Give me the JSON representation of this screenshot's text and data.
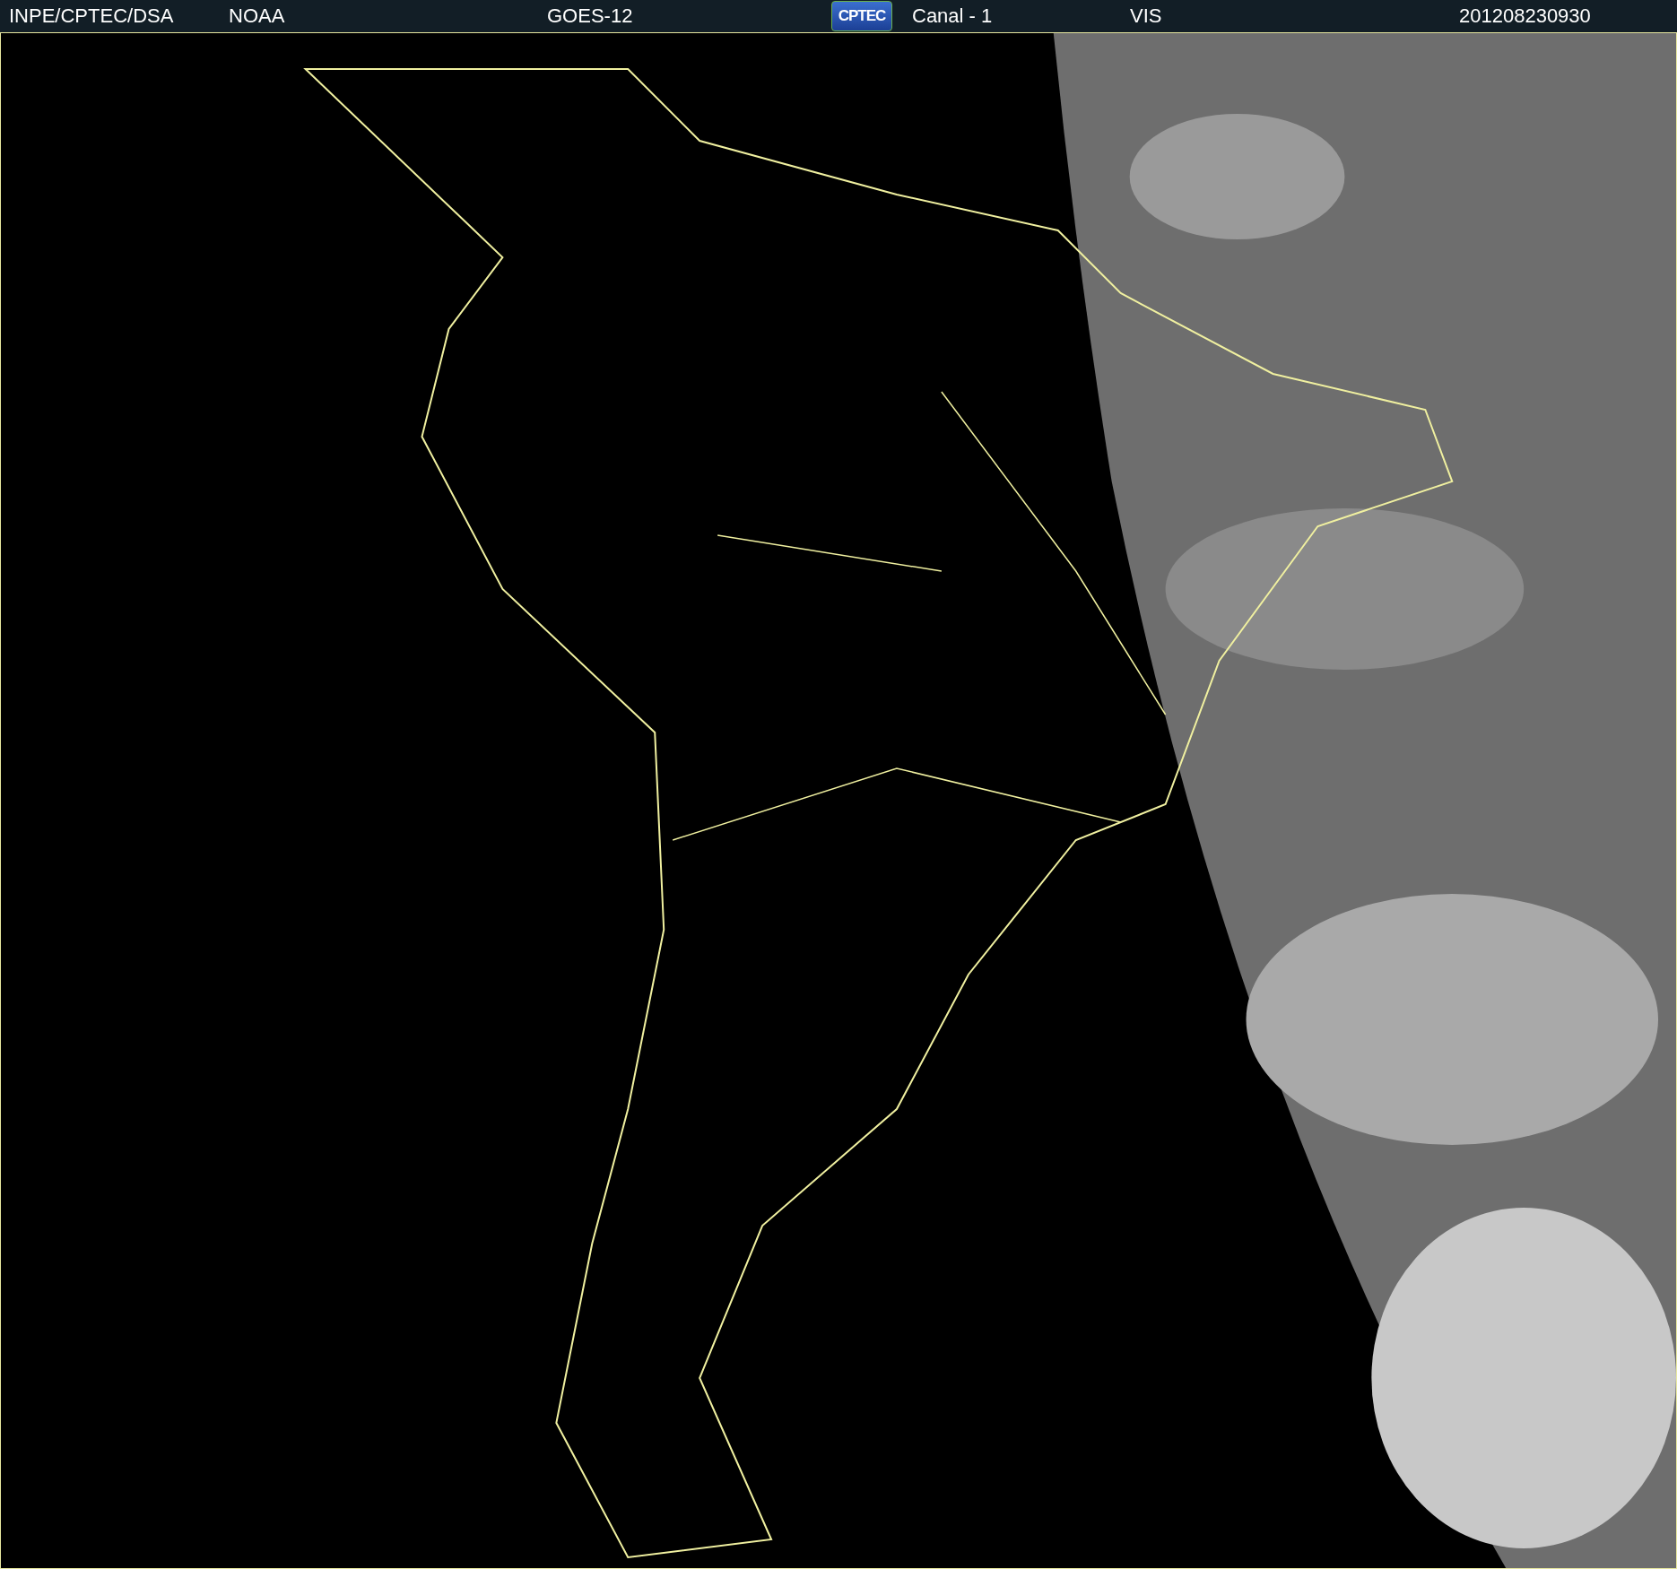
{
  "header": {
    "items": [
      {
        "kind": "text",
        "text": "INPE/CPTEC/DSA"
      },
      {
        "kind": "text",
        "text": "NOAA"
      },
      {
        "kind": "text",
        "text": "GOES-12"
      },
      {
        "kind": "logo",
        "text": "CPTEC"
      },
      {
        "kind": "text",
        "text": "Canal - 1"
      },
      {
        "kind": "text",
        "text": "VIS"
      },
      {
        "kind": "text",
        "text": "201208230930"
      }
    ]
  }
}
